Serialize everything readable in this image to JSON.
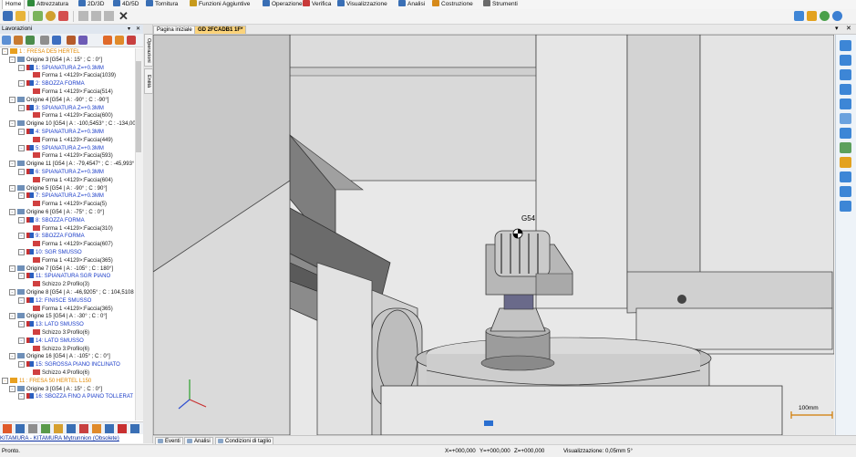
{
  "menubar": {
    "items": [
      {
        "label": "Home",
        "color": "#3a6fb5"
      },
      {
        "label": "Attrezzatura",
        "color": "#2f8a3b"
      },
      {
        "label": "2D/3D",
        "color": "#3a6fb5"
      },
      {
        "label": "4D/5D",
        "color": "#3a6fb5"
      },
      {
        "label": "Tornitura",
        "color": "#3a6fb5"
      },
      {
        "label": "Funzioni Aggiuntive",
        "color": "#c79a1c"
      },
      {
        "label": "Operazione",
        "color": "#3a6fb5"
      },
      {
        "label": "Verifica",
        "color": "#c83a3a"
      },
      {
        "label": "Visualizzazione",
        "color": "#3a6fb5"
      },
      {
        "label": "Analisi",
        "color": "#3a6fb5"
      },
      {
        "label": "Costruzione",
        "color": "#d68a1a"
      },
      {
        "label": "Strumenti",
        "color": "#6b6b6b"
      }
    ]
  },
  "left_panel": {
    "title": "Lavorazioni",
    "machine": "KITAMURA - KITAMURA Mytrunnion (Obsolete)",
    "tree": [
      {
        "level": 0,
        "kind": "job",
        "text": "1 : FRESA DE5 HERTEL"
      },
      {
        "level": 1,
        "kind": "origin",
        "text": "Origine 3 [G54 | A : 15° ; C : 0°]"
      },
      {
        "level": 2,
        "kind": "op",
        "text": "1: SPIANATURA Z=+0.3MM"
      },
      {
        "level": 3,
        "kind": "geo",
        "text": "Forma 1 <4129>:Faccia(1039)"
      },
      {
        "level": 2,
        "kind": "op",
        "text": "2: SBOZZA FORMA"
      },
      {
        "level": 3,
        "kind": "geo",
        "text": "Forma 1 <4129>:Faccia(514)"
      },
      {
        "level": 1,
        "kind": "origin",
        "text": "Origine 4 [G54 | A : -90° ; C : -90°]"
      },
      {
        "level": 2,
        "kind": "op",
        "text": "3: SPIANATURA Z=+0.3MM"
      },
      {
        "level": 3,
        "kind": "geo",
        "text": "Forma 1 <4129>:Faccia(600)"
      },
      {
        "level": 1,
        "kind": "origin",
        "text": "Origine 10 [G54 | A : -100,5453° ; C : -134,00"
      },
      {
        "level": 2,
        "kind": "op",
        "text": "4: SPIANATURA Z=+0.3MM"
      },
      {
        "level": 3,
        "kind": "geo",
        "text": "Forma 1 <4129>:Faccia(449)"
      },
      {
        "level": 2,
        "kind": "op",
        "text": "5: SPIANATURA Z=+0.3MM"
      },
      {
        "level": 3,
        "kind": "geo",
        "text": "Forma 1 <4129>:Faccia(593)"
      },
      {
        "level": 1,
        "kind": "origin",
        "text": "Origine 11 [G54 | A : -79,4547° ; C : -45,993°"
      },
      {
        "level": 2,
        "kind": "op",
        "text": "6: SPIANATURA Z=+0.3MM"
      },
      {
        "level": 3,
        "kind": "geo",
        "text": "Forma 1 <4129>:Faccia(604)"
      },
      {
        "level": 1,
        "kind": "origin",
        "text": "Origine 5 [G54 | A : -90° ; C : 90°]"
      },
      {
        "level": 2,
        "kind": "op",
        "text": "7: SPIANATURA Z=+0.3MM"
      },
      {
        "level": 3,
        "kind": "geo",
        "text": "Forma 1 <4129>:Faccia(5)"
      },
      {
        "level": 1,
        "kind": "origin",
        "text": "Origine 6 [G54 | A : -75° ; C : 0°]"
      },
      {
        "level": 2,
        "kind": "op",
        "text": "8: SBOZZA FORMA"
      },
      {
        "level": 3,
        "kind": "geo",
        "text": "Forma 1 <4129>:Faccia(310)"
      },
      {
        "level": 2,
        "kind": "op",
        "text": "9: SBOZZA FORMA"
      },
      {
        "level": 3,
        "kind": "geo",
        "text": "Forma 1 <4129>:Faccia(607)"
      },
      {
        "level": 2,
        "kind": "op",
        "text": "10: SGR SMUSSO"
      },
      {
        "level": 3,
        "kind": "geo",
        "text": "Forma 1 <4129>:Faccia(365)"
      },
      {
        "level": 1,
        "kind": "origin",
        "text": "Origine 7 [G54 | A : -105° ; C : 180°]"
      },
      {
        "level": 2,
        "kind": "op",
        "text": "11: SPIANATURA SGR PIANO"
      },
      {
        "level": 3,
        "kind": "geo",
        "text": "Schizzo 2:Profilo(3)"
      },
      {
        "level": 1,
        "kind": "origin",
        "text": "Origine 8 [G54 | A : -46,9205° ; C : 104,5108"
      },
      {
        "level": 2,
        "kind": "op",
        "text": "12: FINISCE SMUSSO"
      },
      {
        "level": 3,
        "kind": "geo",
        "text": "Forma 1 <4129>:Faccia(365)"
      },
      {
        "level": 1,
        "kind": "origin",
        "text": "Origine 15 [G54 | A : -30° ; C : 0°]"
      },
      {
        "level": 2,
        "kind": "op",
        "text": "13: LATO SMUSSO"
      },
      {
        "level": 3,
        "kind": "geo",
        "text": "Schizzo 3:Profilo(6)"
      },
      {
        "level": 2,
        "kind": "op",
        "text": "14: LATO SMUSSO"
      },
      {
        "level": 3,
        "kind": "geo",
        "text": "Schizzo 3:Profilo(6)"
      },
      {
        "level": 1,
        "kind": "origin",
        "text": "Origine 16 [G54 | A : -105° ; C : 0°]"
      },
      {
        "level": 2,
        "kind": "op",
        "text": "15: SGROSSA PIANO INCLINATO"
      },
      {
        "level": 3,
        "kind": "geo",
        "text": "Schizzo 4:Profilo(6)"
      },
      {
        "level": 0,
        "kind": "job",
        "text": "11 : FRESA 50 HERTEL L150"
      },
      {
        "level": 1,
        "kind": "origin",
        "text": "Origine 3 [G54 | A : 15° ; C : 0°]"
      },
      {
        "level": 2,
        "kind": "op",
        "text": "16: SBOZZA FINO A PIANO TOLLERAT"
      }
    ]
  },
  "side_tabs": [
    "Operazioni",
    "Entità"
  ],
  "doc_tabs": [
    {
      "label": "Pagina iniziale",
      "active": false
    },
    {
      "label": "GD 2FCADB1 1F*",
      "active": true
    }
  ],
  "viewport": {
    "origin_label": "G54",
    "scale_label": "100mm"
  },
  "bottom_tabs": [
    "Eventi",
    "Analisi",
    "Condizioni di taglio"
  ],
  "status": {
    "text": "Pronto.",
    "x": "X=+000,000",
    "y": "Y=+000,000",
    "z": "Z=+000,000",
    "view": "Visualizzazione: 0,05mm 5°"
  }
}
